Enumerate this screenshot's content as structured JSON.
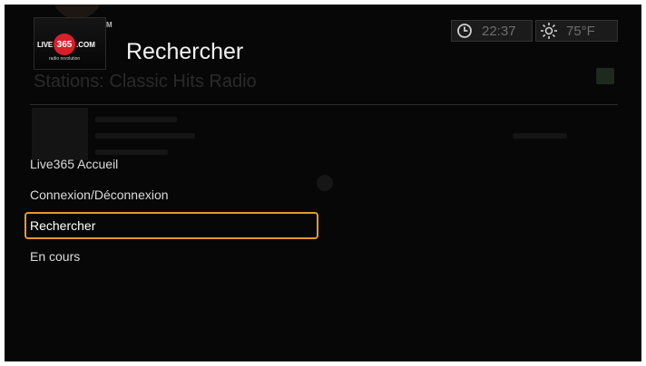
{
  "header": {
    "title": "Rechercher",
    "logo": {
      "brand_left": "LIVE",
      "brand_number": "365",
      "brand_right": ".COM",
      "tagline": "radio revolution",
      "mark": "M"
    }
  },
  "status": {
    "time": "22:37",
    "temperature": "75°F",
    "time_icon": "clock-icon",
    "weather_icon": "sun-icon"
  },
  "background": {
    "title": "Stations: Classic Hits Radio"
  },
  "menu": {
    "items": [
      {
        "label": "Live365 Accueil",
        "selected": false
      },
      {
        "label": "Connexion/Déconnexion",
        "selected": false
      },
      {
        "label": "Rechercher",
        "selected": true
      },
      {
        "label": "En cours",
        "selected": false
      }
    ]
  },
  "colors": {
    "background": "#070707",
    "selection_border": "#e39a32",
    "logo_red": "#d9202a"
  }
}
